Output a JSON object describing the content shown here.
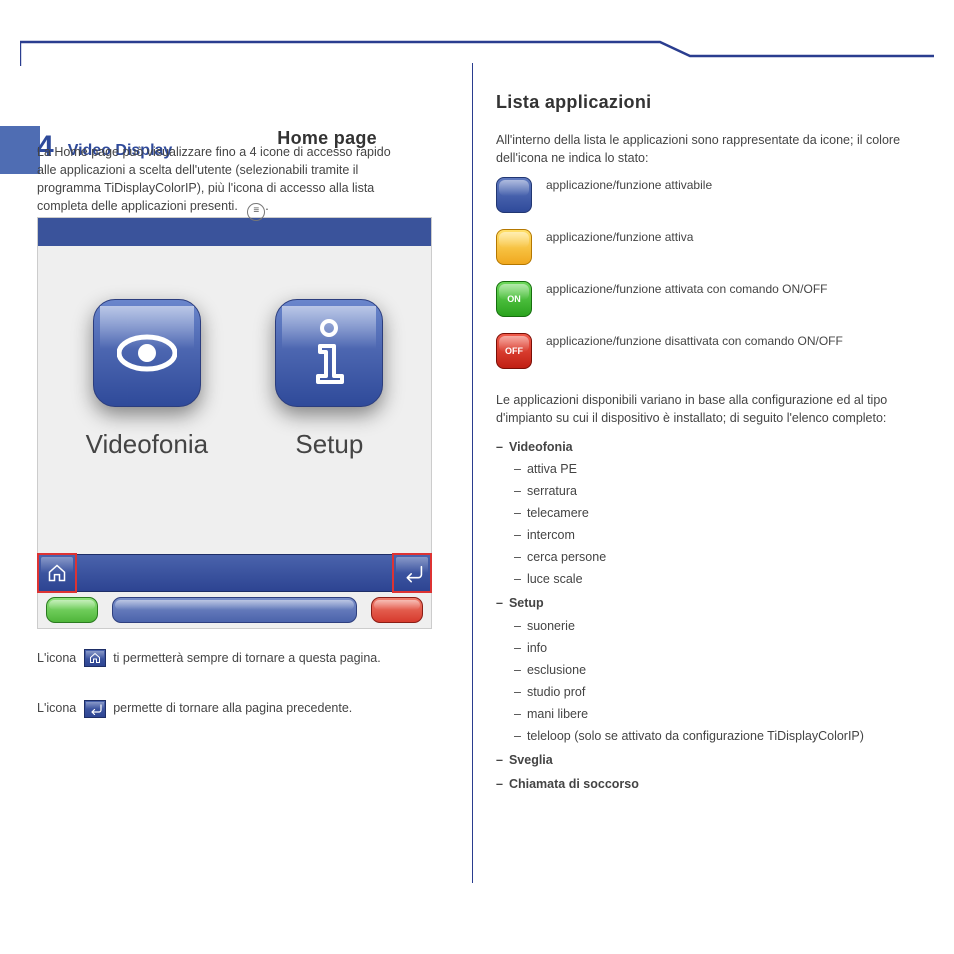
{
  "page": {
    "section_number": "4",
    "doc_title": "Video Display"
  },
  "left": {
    "heading": "Home page",
    "intro": "La Home page può visualizzare fino a 4 icone di accesso rapido alle applicazioni a scelta dell'utente (selezionabili tramite il programma TiDisplayColorIP), più l'icona di accesso alla lista completa delle applicazioni presenti.",
    "tile_videofonia": "Videofonia",
    "tile_setup": "Setup",
    "after_paragraph_1": "L'icona",
    "after_home_text": "ti permetterà sempre di tornare a questa pagina.",
    "after_paragraph_2": "L'icona",
    "after_back_text": "permette di tornare alla pagina precedente.",
    "list_icon_label": "≡"
  },
  "right": {
    "heading": "Lista applicazioni",
    "intro": "All'interno della lista le applicazioni sono rappresentate da icone; il colore dell'icona ne indica lo stato:",
    "legend": {
      "blue": "applicazione/funzione attivabile",
      "yellow": "applicazione/funzione attiva",
      "green_label": "ON",
      "green": "applicazione/funzione attivata con comando ON/OFF",
      "red_label": "OFF",
      "red": "applicazione/funzione disattivata con comando ON/OFF"
    },
    "menu_intro": "Le applicazioni disponibili variano in base alla configurazione ed al tipo d'impianto su cui il dispositivo è installato; di seguito l'elenco completo:",
    "menu": {
      "videofonia": "Videofonia",
      "videofonia_items": [
        "attiva PE",
        "serratura",
        "telecamere",
        "intercom",
        "cerca persone",
        "luce scale"
      ],
      "setup": "Setup",
      "setup_items": [
        "suonerie",
        "info",
        "esclusione",
        "studio prof",
        "mani libere",
        "teleloop (solo se attivato da configurazione TiDisplayColorIP)"
      ],
      "sveglia": "Sveglia",
      "chiamata": "Chiamata di soccorso"
    }
  },
  "colors": {
    "brand_blue": "#2f4a9a",
    "accent": "#4f6db3"
  }
}
